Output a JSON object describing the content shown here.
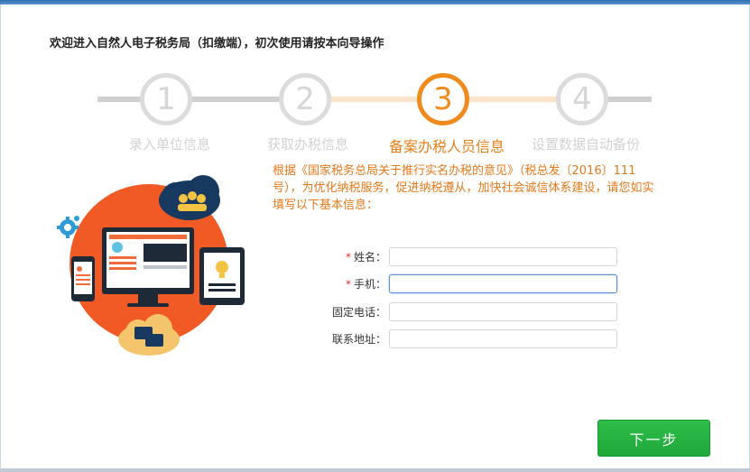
{
  "header": {
    "welcome": "欢迎进入自然人电子税务局（扣缴端），初次使用请按本向导操作"
  },
  "stepper": {
    "steps": [
      {
        "number": "1",
        "label": "录入单位信息",
        "state": "inactive"
      },
      {
        "number": "2",
        "label": "获取办税信息",
        "state": "inactive"
      },
      {
        "number": "3",
        "label": "备案办税人员信息",
        "state": "active"
      },
      {
        "number": "4",
        "label": "设置数据自动备份",
        "state": "inactive"
      }
    ],
    "active_color": "#ef8a1c",
    "inactive_color": "#dcdcdc"
  },
  "notice": {
    "text": "根据《国家税务总局关于推行实名办税的意见》（税总发〔2016〕111号），为优化纳税服务，促进纳税遵从，加快社会诚信体系建设，请您如实填写以下基本信息："
  },
  "form": {
    "name": {
      "label": "姓名：",
      "required": "*",
      "value": ""
    },
    "phone": {
      "label": "手机：",
      "required": "*",
      "value": ""
    },
    "landline": {
      "label": "固定电话：",
      "value": ""
    },
    "address": {
      "label": "联系地址：",
      "value": ""
    }
  },
  "actions": {
    "next_label": "下一步",
    "next_color": "#22b03f"
  },
  "icons": [
    "gear-icon",
    "users-cloud-icon",
    "chat-cloud-icon",
    "monitor-icon",
    "phone-device-icon",
    "tablet-lightbulb-icon"
  ]
}
